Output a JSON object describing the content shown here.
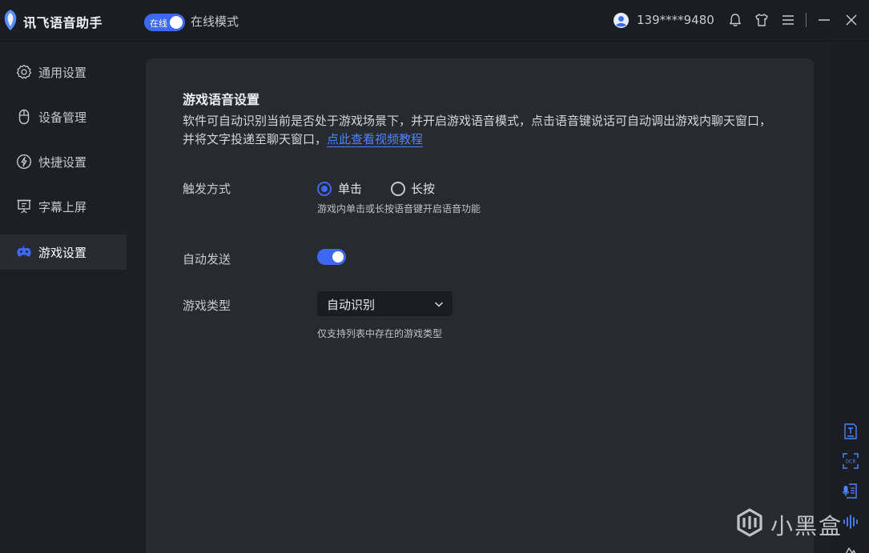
{
  "app": {
    "title": "讯飞语音助手"
  },
  "header": {
    "online_toggle_label": "在线",
    "mode_label": "在线模式",
    "phone": "139****9480"
  },
  "sidebar": {
    "items": [
      {
        "label": "通用设置",
        "icon": "gear-icon"
      },
      {
        "label": "设备管理",
        "icon": "mouse-icon"
      },
      {
        "label": "快捷设置",
        "icon": "lightning-icon"
      },
      {
        "label": "字幕上屏",
        "icon": "presentation-icon"
      },
      {
        "label": "游戏设置",
        "icon": "gamepad-icon",
        "active": true
      }
    ]
  },
  "main": {
    "section_title": "游戏语音设置",
    "description": "软件可自动识别当前是否处于游戏场景下，并开启游戏语音模式，点击语音键说话可自动调出游戏内聊天窗口，并将文字投递至聊天窗口，",
    "tutorial_link": "点此查看视频教程",
    "trigger": {
      "label": "触发方式",
      "options": [
        "单击",
        "长按"
      ],
      "selected": "单击",
      "hint": "游戏内单击或长按语音键开启语音功能"
    },
    "auto_send": {
      "label": "自动发送",
      "enabled": true
    },
    "game_type": {
      "label": "游戏类型",
      "value": "自动识别",
      "hint": "仅支持列表中存在的游戏类型"
    }
  },
  "rail": {
    "icons": [
      "document-text-icon",
      "ocr-scan-icon",
      "voice-document-icon",
      "audio-wave-icon",
      "mountain-icon"
    ]
  },
  "watermark": {
    "text": "小黑盒"
  },
  "colors": {
    "accent": "#3c69ef",
    "link": "#4d84ff",
    "panel": "#282a32",
    "background": "#1d1f26"
  }
}
